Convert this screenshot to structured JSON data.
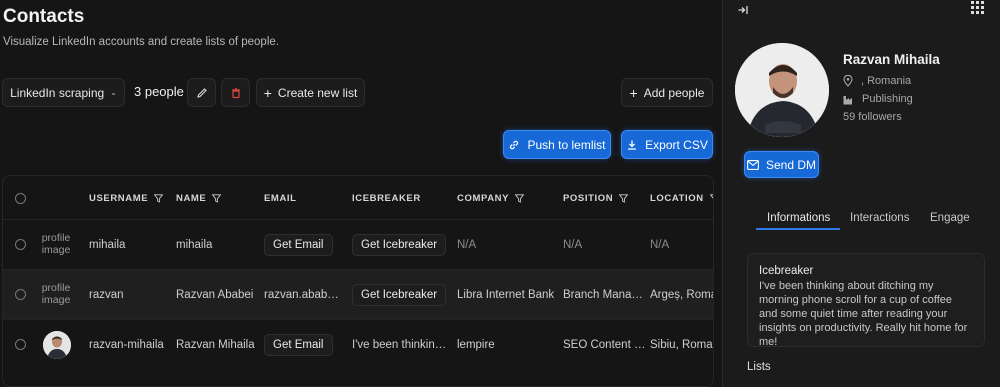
{
  "page": {
    "title": "Contacts",
    "subtitle": "Visualize LinkedIn accounts and create lists of people."
  },
  "toolbar": {
    "list_select": "LinkedIn scraping",
    "count": "3 people",
    "create_list": "Create new list",
    "add_people": "Add people",
    "push": "Push to lemlist",
    "export": "Export CSV"
  },
  "table": {
    "headers": {
      "username": "USERNAME",
      "name": "NAME",
      "email": "EMAIL",
      "icebreaker": "ICEBREAKER",
      "company": "COMPANY",
      "position": "POSITION",
      "location": "LOCATION"
    },
    "rows": [
      {
        "profile_alt": "profile image",
        "username": "mihaila",
        "name": "mihaila",
        "email": "Get Email",
        "icebreaker": "Get Icebreaker",
        "company": "N/A",
        "position": "N/A",
        "location": "N/A"
      },
      {
        "profile_alt": "profile image",
        "username": "razvan",
        "name": "Razvan Ababei",
        "email": "razvan.ababei...",
        "icebreaker": "Get Icebreaker",
        "company": "Libra Internet Bank",
        "position": "Branch Manager",
        "location": "Argeș, Romar"
      },
      {
        "profile_alt": "",
        "username": "razvan-mihaila",
        "name": "Razvan Mihaila",
        "email": "Get Email",
        "icebreaker": "I've been thinking...",
        "company": "lempire",
        "position": "SEO Content W...",
        "location": "Sibiu, Romani"
      }
    ]
  },
  "panel": {
    "name": "Razvan Mihaila",
    "location": ", Romania",
    "industry": "Publishing",
    "followers": "59 followers",
    "send_dm": "Send DM",
    "tabs": [
      "Informations",
      "Interactions",
      "Engage"
    ],
    "icebreaker_title": "Icebreaker",
    "icebreaker_text": "I've been thinking about ditching my morning phone scroll for a cup of coffee and some quiet time after reading your insights on productivity. Really hit home for me!",
    "lists_label": "Lists"
  },
  "colors": {
    "accent": "#1769d8",
    "danger": "#e0443f",
    "background": "#151515"
  }
}
